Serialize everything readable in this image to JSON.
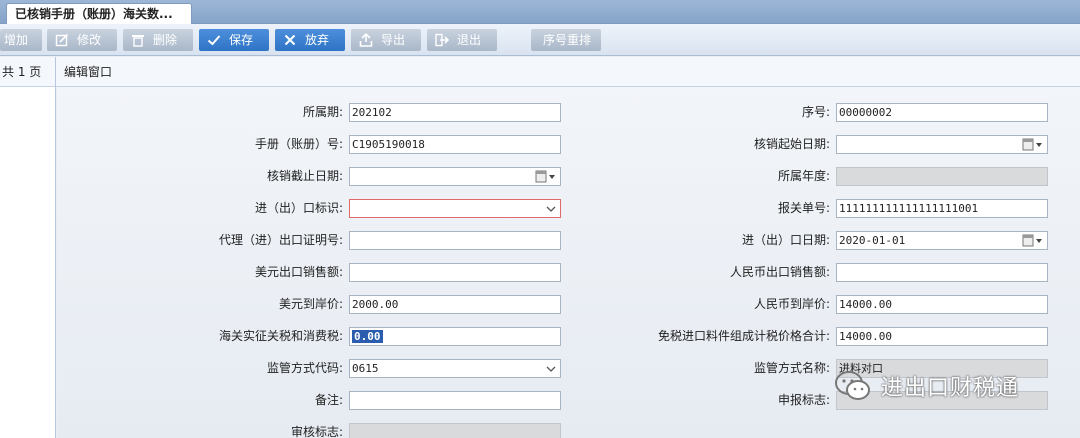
{
  "tab": {
    "title": "已核销手册（账册）海关数..."
  },
  "toolbar": {
    "add": "增加",
    "edit": "修改",
    "delete": "删除",
    "save": "保存",
    "discard": "放弃",
    "export": "导出",
    "exit": "退出",
    "reorder": "序号重排"
  },
  "pager": {
    "text": "共 1 页"
  },
  "window": {
    "title": "编辑窗口"
  },
  "form": {
    "period": {
      "label": "所属期:",
      "value": "202102"
    },
    "seq": {
      "label": "序号:",
      "value": "00000002"
    },
    "manual_no": {
      "label": "手册（账册）号:",
      "value": "C1905190018"
    },
    "verify_start": {
      "label": "核销起始日期:",
      "value": ""
    },
    "verify_end": {
      "label": "核销截止日期:",
      "value": ""
    },
    "year": {
      "label": "所属年度:",
      "value": ""
    },
    "io_flag": {
      "label": "进（出）口标识:",
      "value": ""
    },
    "declaration_no": {
      "label": "报关单号:",
      "value": "111111111111111111001"
    },
    "agent_cert": {
      "label": "代理（进）出口证明号:",
      "value": ""
    },
    "io_date": {
      "label": "进（出）口日期:",
      "value": "2020-01-01"
    },
    "usd_export_sales": {
      "label": "美元出口销售额:",
      "value": ""
    },
    "rmb_export_sales": {
      "label": "人民币出口销售额:",
      "value": ""
    },
    "usd_cif": {
      "label": "美元到岸价:",
      "value": "2000.00"
    },
    "rmb_cif": {
      "label": "人民币到岸价:",
      "value": "14000.00"
    },
    "customs_tax": {
      "label": "海关实征关税和消费税:",
      "value": "0.00"
    },
    "duty_free_total": {
      "label": "免税进口料件组成计税价格合计:",
      "value": "14000.00"
    },
    "supervision_code": {
      "label": "监管方式代码:",
      "value": "0615"
    },
    "supervision_name": {
      "label": "监管方式名称:",
      "value": "进料对口"
    },
    "remark": {
      "label": "备注:",
      "value": ""
    },
    "declare_flag": {
      "label": "申报标志:",
      "value": ""
    },
    "audit_flag": {
      "label": "审核标志:",
      "value": ""
    }
  },
  "watermark": {
    "text": "进出口财税通",
    "icon": "wechat-icon"
  }
}
